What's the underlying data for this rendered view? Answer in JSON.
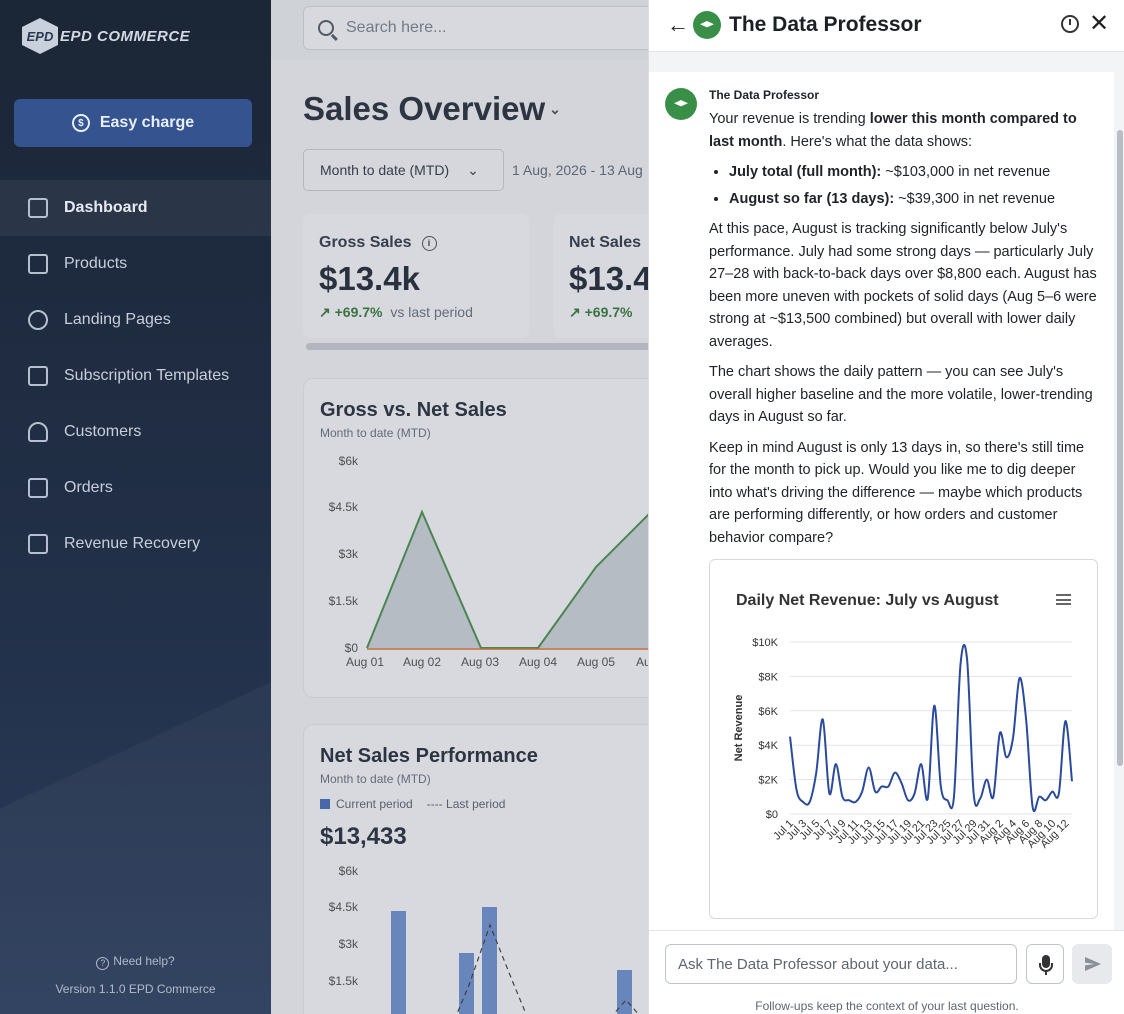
{
  "sidebar": {
    "logo_text": "EPD COMMERCE",
    "easy_charge_label": "Easy charge",
    "items": [
      {
        "label": "Dashboard",
        "icon": "dashboard-icon"
      },
      {
        "label": "Products",
        "icon": "products-icon"
      },
      {
        "label": "Landing Pages",
        "icon": "globe-icon"
      },
      {
        "label": "Subscription Templates",
        "icon": "template-icon"
      },
      {
        "label": "Customers",
        "icon": "users-icon"
      },
      {
        "label": "Orders",
        "icon": "orders-icon"
      },
      {
        "label": "Revenue Recovery",
        "icon": "money-icon"
      }
    ],
    "help": "Need help?",
    "version": "Version 1.1.0 EPD Commerce"
  },
  "main": {
    "search_placeholder": "Search here...",
    "title": "Sales Overview",
    "period": "Month to date (MTD)",
    "date_range": "1 Aug, 2026 - 13 Aug",
    "kpis": [
      {
        "title": "Gross Sales",
        "value": "$13.4k",
        "delta": "+69.7%",
        "vs": "vs last period"
      },
      {
        "title": "Net Sales",
        "value": "$13.4",
        "delta": "+69.7%",
        "vs": ""
      }
    ],
    "gross_vs_net": {
      "title": "Gross vs. Net Sales",
      "subtitle": "Month to date (MTD)",
      "y_ticks": [
        "$6k",
        "$4.5k",
        "$3k",
        "$1.5k",
        "$0"
      ],
      "x_ticks": [
        "Aug 01",
        "Aug 02",
        "Aug 03",
        "Aug 04",
        "Aug 05",
        "Au"
      ]
    },
    "net_perf": {
      "title": "Net Sales Performance",
      "subtitle": "Month to date (MTD)",
      "legend_current": "Current period",
      "legend_last": "Last period",
      "total": "$13,433",
      "y_ticks": [
        "$6k",
        "$4.5k",
        "$3k",
        "$1.5k"
      ]
    }
  },
  "panel": {
    "title": "The Data Professor",
    "author": "The Data Professor",
    "intro_a": "Your revenue is trending ",
    "intro_b": "lower this month compared to last month",
    "intro_c": ". Here's what the data shows:",
    "bullet1_b": "July total (full month):",
    "bullet1_t": " ~$103,000 in net revenue",
    "bullet2_b": "August so far (13 days):",
    "bullet2_t": " ~$39,300 in net revenue",
    "para2": "At this pace, August is tracking significantly below July's performance. July had some strong days — particularly July 27–28 with back-to-back days over $8,800 each. August has been more uneven with pockets of solid days (Aug 5–6 were strong at ~$13,500 combined) but overall with lower daily averages.",
    "para3": "The chart shows the daily pattern — you can see July's overall higher baseline and the more volatile, lower-trending days in August so far.",
    "para4": "Keep in mind August is only 13 days in, so there's still time for the month to pick up. Would you like me to dig deeper into what's driving the difference — maybe which products are performing differently, or how orders and customer behavior compare?",
    "input_placeholder": "Ask The Data Professor about your data...",
    "footnote": "Follow-ups keep the context of your last question."
  },
  "chart_data": {
    "type": "line",
    "title": "Daily Net Revenue: July vs August",
    "ylabel": "Net Revenue",
    "xlabel": "",
    "ylim": [
      0,
      10000
    ],
    "y_ticks": [
      "$0",
      "$2K",
      "$4K",
      "$6K",
      "$8K",
      "$10K"
    ],
    "x_tick_labels": [
      "Jul 1",
      "Jul 3",
      "Jul 5",
      "Jul 7",
      "Jul 9",
      "Jul 11",
      "Jul 13",
      "Jul 15",
      "Jul 17",
      "Jul 19",
      "Jul 21",
      "Jul 23",
      "Jul 25",
      "Jul 27",
      "Jul 29",
      "Jul 31",
      "Aug 2",
      "Aug 4",
      "Aug 6",
      "Aug 8",
      "Aug 10",
      "Aug 12"
    ],
    "color": "#2b4a9b",
    "x": [
      "Jul 1",
      "Jul 2",
      "Jul 3",
      "Jul 4",
      "Jul 5",
      "Jul 6",
      "Jul 7",
      "Jul 8",
      "Jul 9",
      "Jul 10",
      "Jul 11",
      "Jul 12",
      "Jul 13",
      "Jul 14",
      "Jul 15",
      "Jul 16",
      "Jul 17",
      "Jul 18",
      "Jul 19",
      "Jul 20",
      "Jul 21",
      "Jul 22",
      "Jul 23",
      "Jul 24",
      "Jul 25",
      "Jul 26",
      "Jul 27",
      "Jul 28",
      "Jul 29",
      "Jul 30",
      "Jul 31",
      "Aug 1",
      "Aug 2",
      "Aug 3",
      "Aug 4",
      "Aug 5",
      "Aug 6",
      "Aug 7",
      "Aug 8",
      "Aug 9",
      "Aug 10",
      "Aug 11",
      "Aug 12",
      "Aug 13"
    ],
    "values": [
      4500,
      1400,
      700,
      700,
      2400,
      5500,
      1200,
      2900,
      1000,
      800,
      700,
      1300,
      2700,
      1300,
      1600,
      1600,
      2400,
      1800,
      800,
      1200,
      2900,
      900,
      6300,
      1600,
      800,
      1000,
      8700,
      9000,
      1200,
      900,
      2000,
      1000,
      4700,
      3300,
      4400,
      7900,
      5500,
      400,
      1000,
      800,
      1300,
      1200,
      5400,
      1900
    ]
  }
}
